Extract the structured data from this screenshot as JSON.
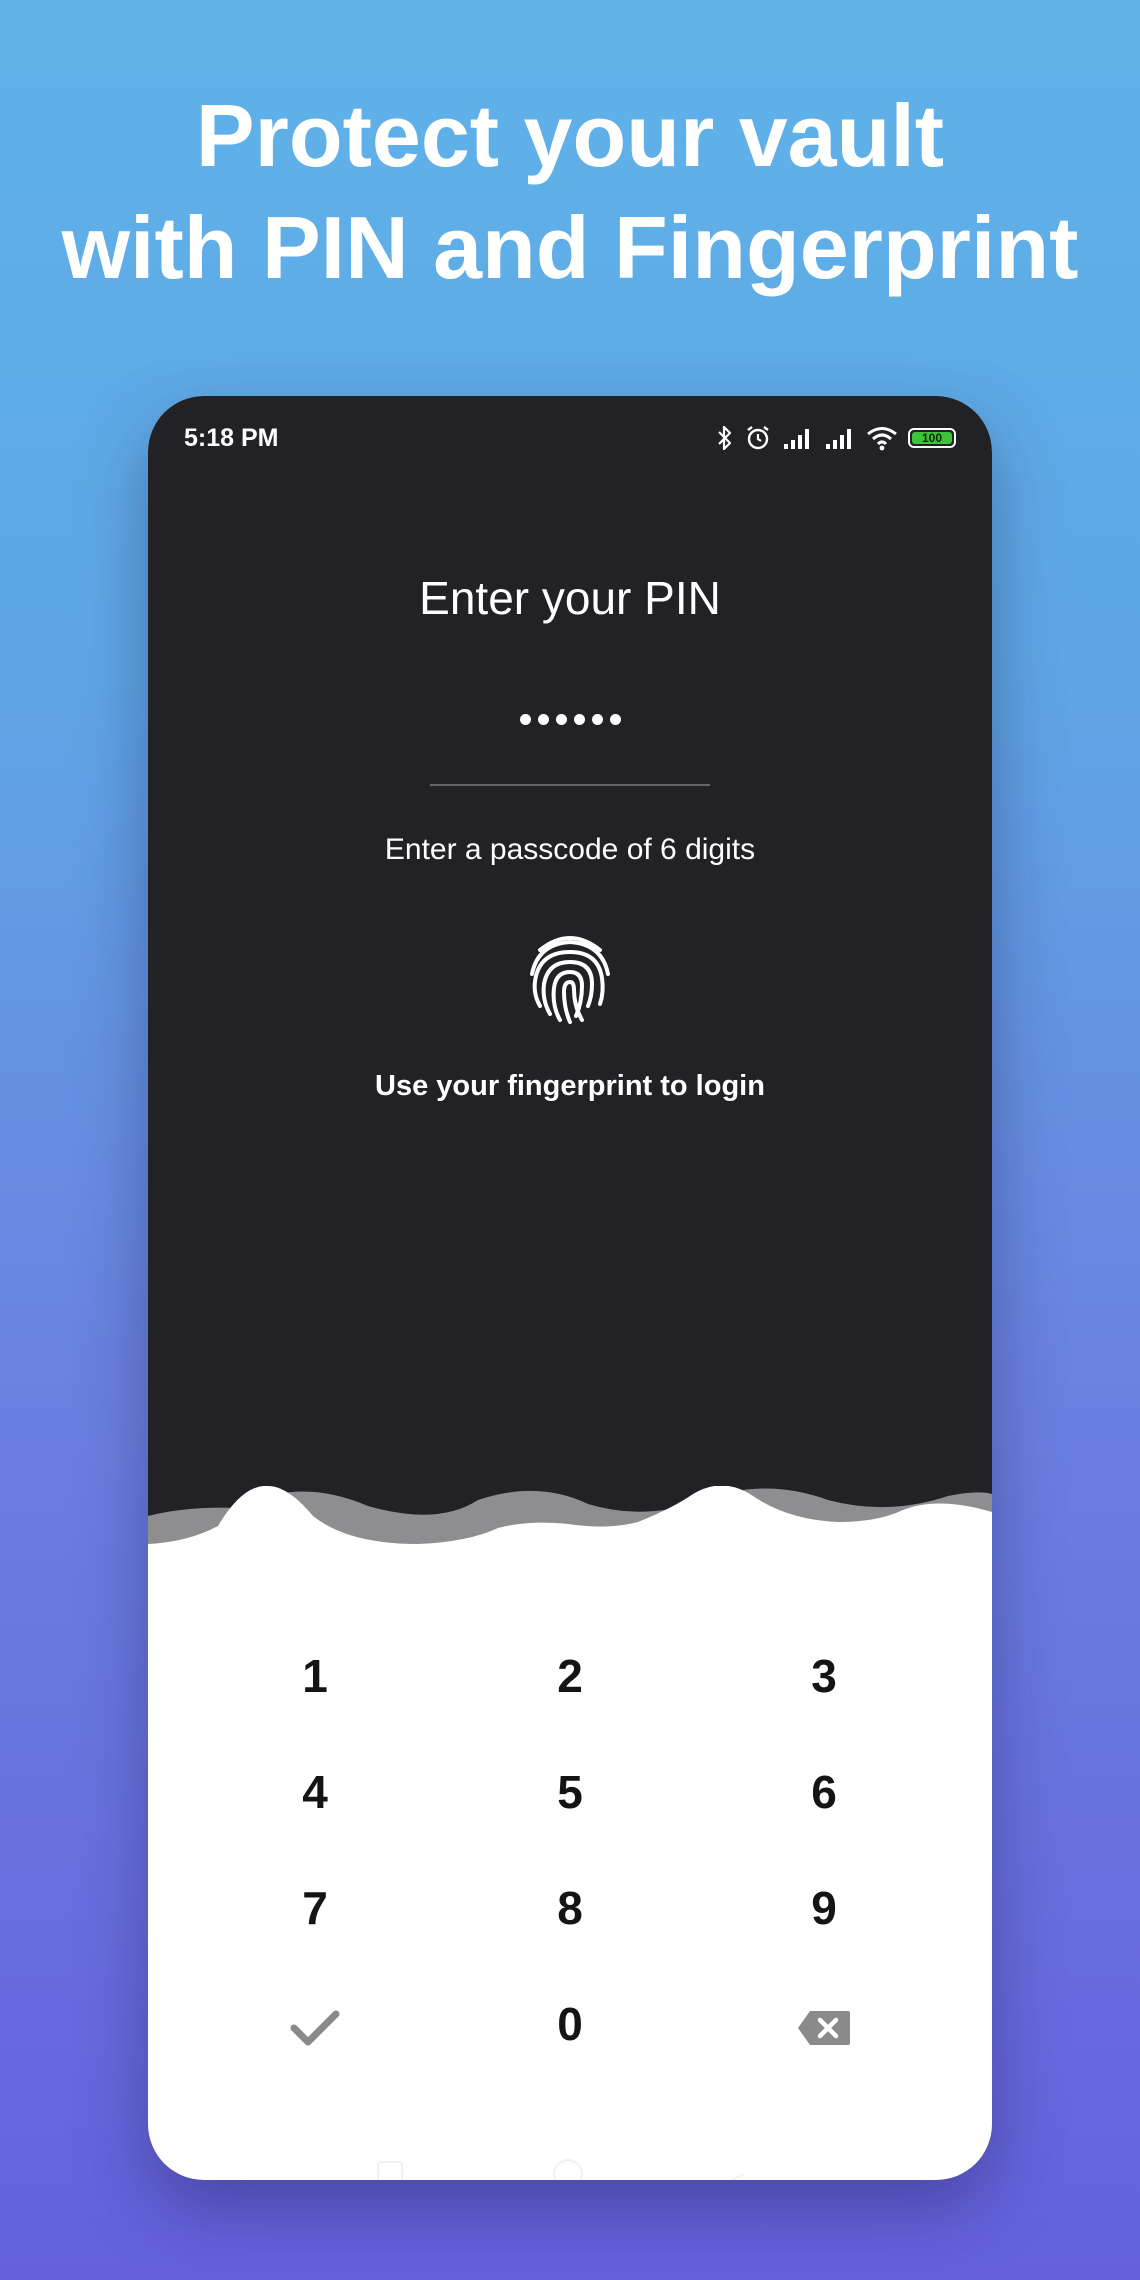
{
  "headline": {
    "line1": "Protect your vault",
    "line2": "with PIN and Fingerprint"
  },
  "status_bar": {
    "time": "5:18 PM",
    "battery": "100",
    "icons": [
      "bluetooth-icon",
      "alarm-icon",
      "signal-icon",
      "signal-icon",
      "wifi-icon",
      "battery-icon"
    ]
  },
  "pin_screen": {
    "title": "Enter your PIN",
    "masked_value": "••••••",
    "digits_entered": 6,
    "hint": "Enter a passcode of 6 digits",
    "fingerprint_label": "Use your fingerprint to login"
  },
  "keypad": {
    "keys": [
      "1",
      "2",
      "3",
      "4",
      "5",
      "6",
      "7",
      "8",
      "9",
      "confirm",
      "0",
      "backspace"
    ],
    "labels": {
      "k1": "1",
      "k2": "2",
      "k3": "3",
      "k4": "4",
      "k5": "5",
      "k6": "6",
      "k7": "7",
      "k8": "8",
      "k9": "9",
      "k0": "0"
    },
    "confirm_icon": "check-icon",
    "delete_icon": "backspace-icon"
  },
  "colors": {
    "background_top": "#5fb2e8",
    "background_bottom": "#6660dd",
    "dark_panel": "#222126",
    "wave": "#8e8e91",
    "battery": "#3ec43a",
    "text_light": "#ffffff",
    "key_text": "#141414",
    "key_icon": "#8a8a8a"
  }
}
